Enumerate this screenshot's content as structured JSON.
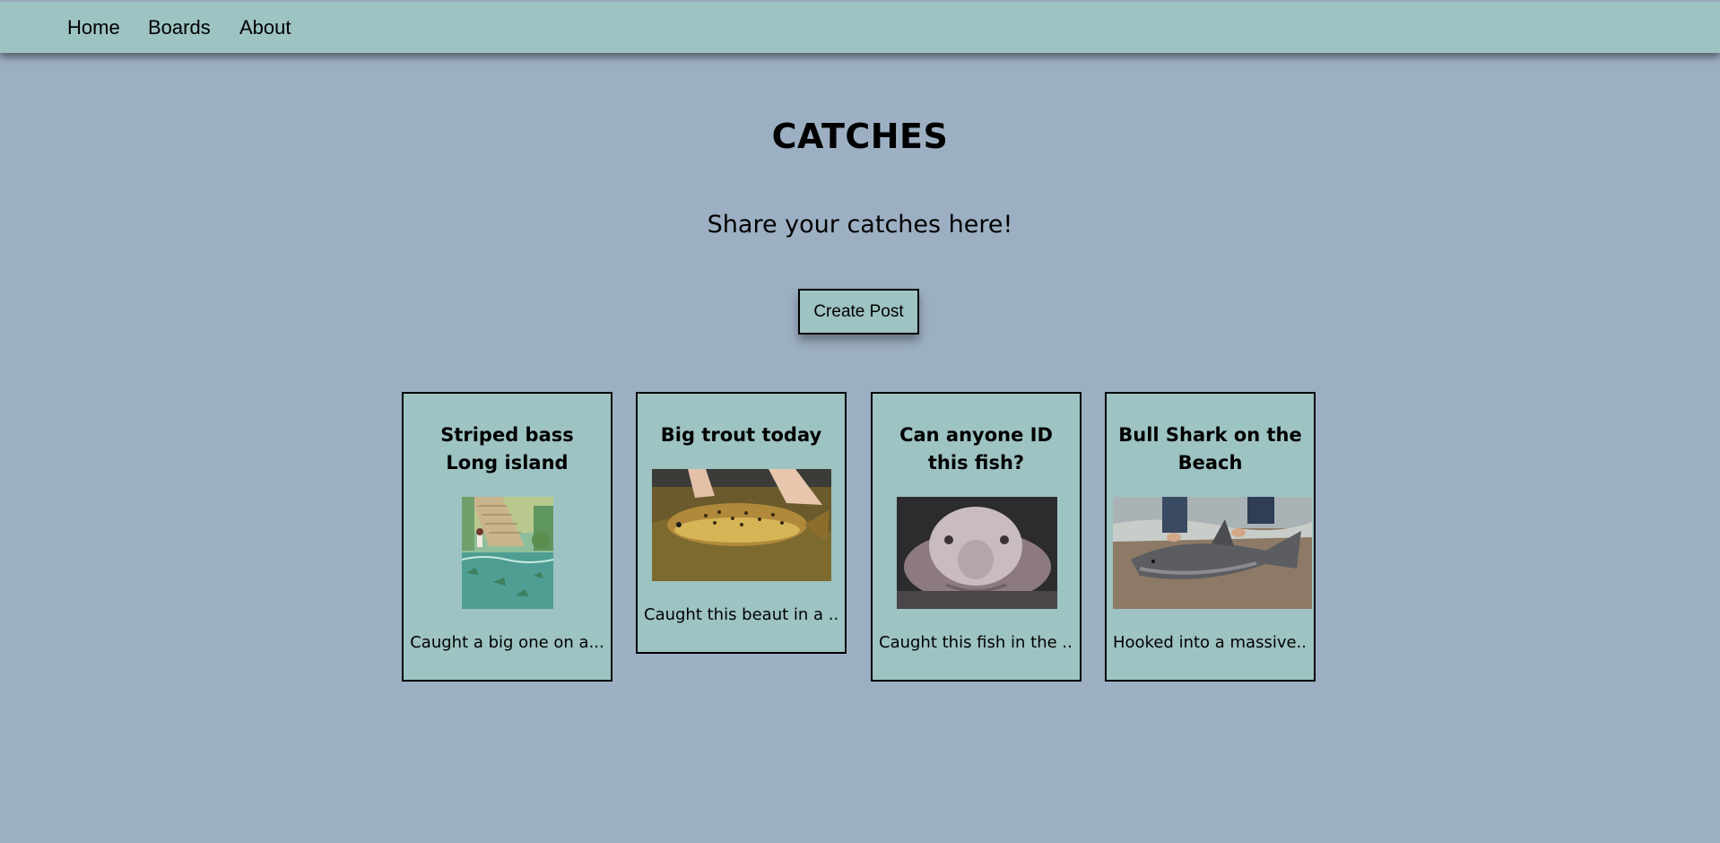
{
  "nav": {
    "home": "Home",
    "boards": "Boards",
    "about": "About"
  },
  "header": {
    "title": "CATCHES",
    "subtitle": "Share your catches here!"
  },
  "actions": {
    "create_post": "Create Post"
  },
  "posts": [
    {
      "title": "Striped bass Long island",
      "excerpt": "Caught a big one on a...",
      "image": "painted stream scene"
    },
    {
      "title": "Big trout today",
      "excerpt": "Caught this beaut in a ...",
      "image": "brown trout held in water"
    },
    {
      "title": "Can anyone ID this fish?",
      "excerpt": "Caught this fish in the ...",
      "image": "blobfish"
    },
    {
      "title": "Bull Shark on the Beach",
      "excerpt": "Hooked into a massive...",
      "image": "shark on sand"
    }
  ],
  "colors": {
    "page_bg": "#9db0c3",
    "nav_bg": "#9dc3c2",
    "card_bg": "#9dc3c2",
    "border": "#000000"
  }
}
